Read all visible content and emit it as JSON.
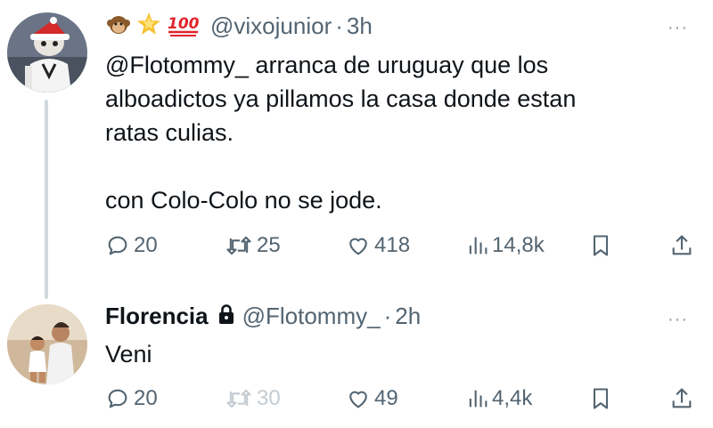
{
  "tweets": [
    {
      "emojis": [
        "🐒",
        "🌟",
        "💯"
      ],
      "handle": "@vixojunior",
      "separator": "·",
      "time": "3h",
      "text_line1": "@Flotommy_ arranca de uruguay que los",
      "text_line2": "alboadictos ya pillamos la casa donde estan",
      "text_line3": "ratas culias.",
      "text_line4": "con Colo-Colo no se jode.",
      "replies": "20",
      "retweets": "25",
      "likes": "418",
      "views": "14,8k",
      "more": "···"
    },
    {
      "display_name": "Florencia",
      "handle": "@Flotommy_",
      "separator": "·",
      "time": "2h",
      "text": "Veni",
      "replies": "20",
      "retweets": "30",
      "likes": "49",
      "views": "4,4k",
      "more": "···"
    }
  ],
  "colors": {
    "text": "#0f1419",
    "secondary": "#536471",
    "thread_line": "#cfd9de",
    "faded": "#c4ccd2"
  },
  "icons": [
    "reply-icon",
    "retweet-icon",
    "like-icon",
    "views-icon",
    "bookmark-icon",
    "share-icon",
    "lock-icon",
    "more-icon"
  ]
}
